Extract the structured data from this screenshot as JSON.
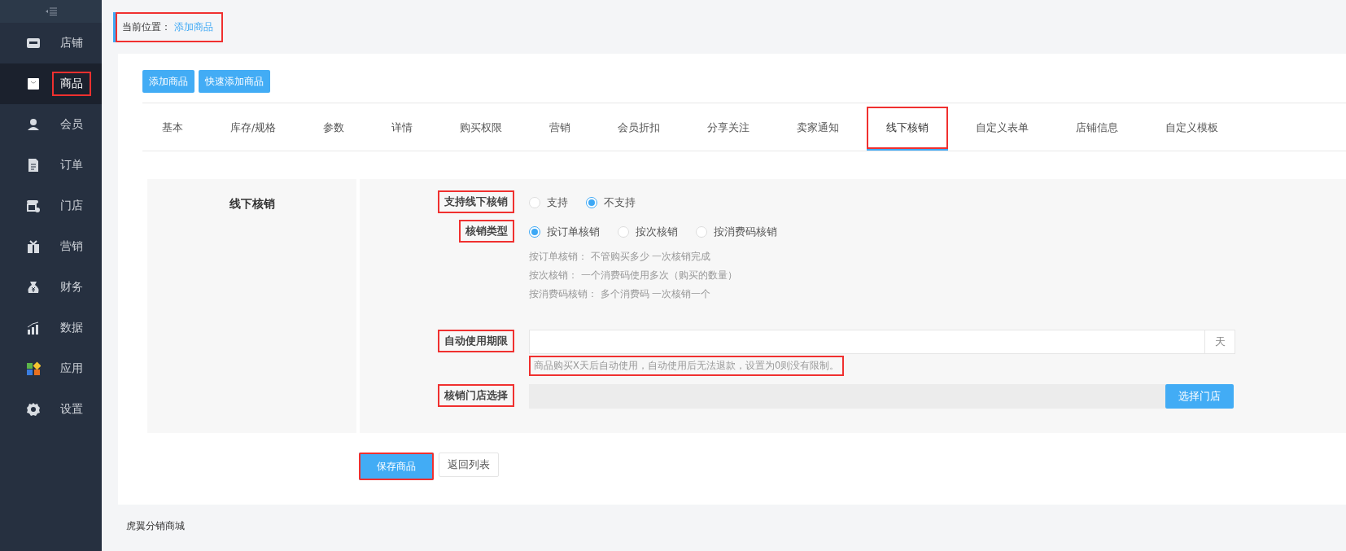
{
  "sidebar": {
    "items": [
      {
        "label": "店铺",
        "selected": false,
        "highlighted": false
      },
      {
        "label": "商品",
        "selected": true,
        "highlighted": true
      },
      {
        "label": "会员",
        "selected": false,
        "highlighted": false
      },
      {
        "label": "订单",
        "selected": false,
        "highlighted": false
      },
      {
        "label": "门店",
        "selected": false,
        "highlighted": false
      },
      {
        "label": "营销",
        "selected": false,
        "highlighted": false
      },
      {
        "label": "财务",
        "selected": false,
        "highlighted": false
      },
      {
        "label": "数据",
        "selected": false,
        "highlighted": false
      },
      {
        "label": "应用",
        "selected": false,
        "highlighted": false
      },
      {
        "label": "设置",
        "selected": false,
        "highlighted": false
      }
    ]
  },
  "breadcrumb": {
    "label": "当前位置：",
    "current": "添加商品",
    "highlighted": true
  },
  "top_buttons": [
    "添加商品",
    "快速添加商品"
  ],
  "tabs": [
    {
      "label": "基本",
      "selected": false,
      "highlighted": false
    },
    {
      "label": "库存/规格",
      "selected": false,
      "highlighted": false
    },
    {
      "label": "参数",
      "selected": false,
      "highlighted": false
    },
    {
      "label": "详情",
      "selected": false,
      "highlighted": false
    },
    {
      "label": "购买权限",
      "selected": false,
      "highlighted": false
    },
    {
      "label": "营销",
      "selected": false,
      "highlighted": false
    },
    {
      "label": "会员折扣",
      "selected": false,
      "highlighted": false
    },
    {
      "label": "分享关注",
      "selected": false,
      "highlighted": false
    },
    {
      "label": "卖家通知",
      "selected": false,
      "highlighted": false
    },
    {
      "label": "线下核销",
      "selected": true,
      "highlighted": true
    },
    {
      "label": "自定义表单",
      "selected": false,
      "highlighted": false
    },
    {
      "label": "店铺信息",
      "selected": false,
      "highlighted": false
    },
    {
      "label": "自定义模板",
      "selected": false,
      "highlighted": false
    }
  ],
  "section": {
    "title": "线下核销",
    "support": {
      "label": "支持线下核销",
      "highlighted": true,
      "options": [
        {
          "label": "支持",
          "selected": false
        },
        {
          "label": "不支持",
          "selected": true
        }
      ]
    },
    "verify_type": {
      "label": "核销类型",
      "highlighted": true,
      "options": [
        {
          "label": "按订单核销",
          "selected": true
        },
        {
          "label": "按次核销",
          "selected": false
        },
        {
          "label": "按消费码核销",
          "selected": false
        }
      ],
      "notes": [
        "按订单核销： 不管购买多少 一次核销完成",
        "按次核销： 一个消费码使用多次（购买的数量）",
        "按消费码核销： 多个消费码 一次核销一个"
      ]
    },
    "auto_use": {
      "label": "自动使用期限",
      "highlighted": true,
      "addon": "天",
      "hint": "商品购买X天后自动使用，自动使用后无法退款，设置为0则没有限制。",
      "hint_highlighted": true
    },
    "store": {
      "label": "核销门店选择",
      "highlighted": true,
      "button": "选择门店"
    }
  },
  "actions": {
    "save": {
      "label": "保存商品",
      "highlighted": true
    },
    "back": {
      "label": "返回列表"
    }
  },
  "footer": "虎翼分销商城"
}
